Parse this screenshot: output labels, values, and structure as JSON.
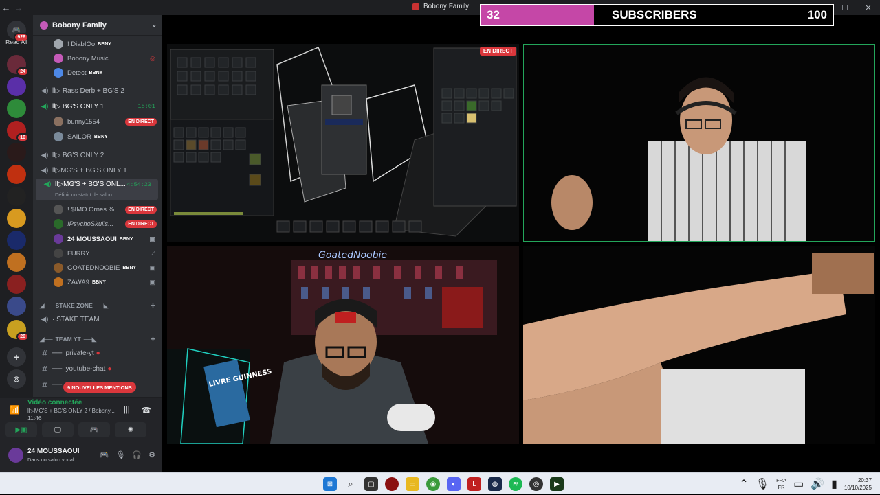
{
  "window": {
    "title": "Bobony Family"
  },
  "servers": {
    "dm_badge": "926",
    "read_all": "Read All",
    "badges": [
      "24",
      "10",
      "20"
    ]
  },
  "guild": {
    "name": "Bobony Family"
  },
  "users_top": [
    {
      "name": "! DiabIOo",
      "tag": "BBNY",
      "color": "#a0a6ad"
    },
    {
      "name": "Bobony Music",
      "tag": "",
      "color": "#c55ab8"
    },
    {
      "name": "Detect",
      "tag": "BBNY",
      "color": "#4d88e6"
    }
  ],
  "channels": {
    "rass": "ll▷ Rass Derb + BG'S 2",
    "bgs1": "ll▷ BG'S ONLY 1",
    "bgs1_time": "18:01",
    "bunny": "bunny1554",
    "sailor": "SAILOR",
    "bgs2": "ll▷ BG'S ONLY 2",
    "mgs1": "ll▷MG'S + BG'S ONLY 1",
    "current": "ll▷MG'S + BG'S ONL...",
    "current_time": "4:54:23",
    "status_hint": "Définir un statut de salon",
    "members": [
      {
        "name": "! $IMO Ornes %",
        "live": true
      },
      {
        "name": "!PsychoSkulls...",
        "live": true
      },
      {
        "name": "24 MOUSSAOUI",
        "tag": "BBNY"
      },
      {
        "name": "FURRY"
      },
      {
        "name": "GOATEDNOOBIE",
        "tag": "BBNY"
      },
      {
        "name": "ZAWA9",
        "tag": "BBNY"
      }
    ],
    "stake_zone": "STAKE ZONE",
    "stake_team": "· STAKE TEAM",
    "team_yt": "TEAM YT",
    "private_yt": "──| private-yt",
    "youtube_chat": "──| youtube-chat",
    "new_mentions": "9 NOUVELLES MENTIONS"
  },
  "live_label": "EN DIRECT",
  "voice": {
    "status": "Vidéo connectée",
    "channel": "ll▷MG'S + BG'S ONLY 2  / Bobony...",
    "time": "11:46"
  },
  "profile": {
    "name": "24 MOUSSAOUI",
    "sub": "Dans un salon vocal"
  },
  "overlay": {
    "current": "32",
    "label": "SUBSCRIBERS",
    "goal": "100",
    "progress": 0.32,
    "color": "#c547a7"
  },
  "stream": {
    "live_badge": "EN DIRECT",
    "neon": "GoatedNoobie",
    "book": "LIVRE GUINNESS"
  },
  "taskbar": {
    "lang_top": "FRA",
    "lang_bottom": "FR",
    "time": "20:37",
    "date": "10/10/2025"
  }
}
